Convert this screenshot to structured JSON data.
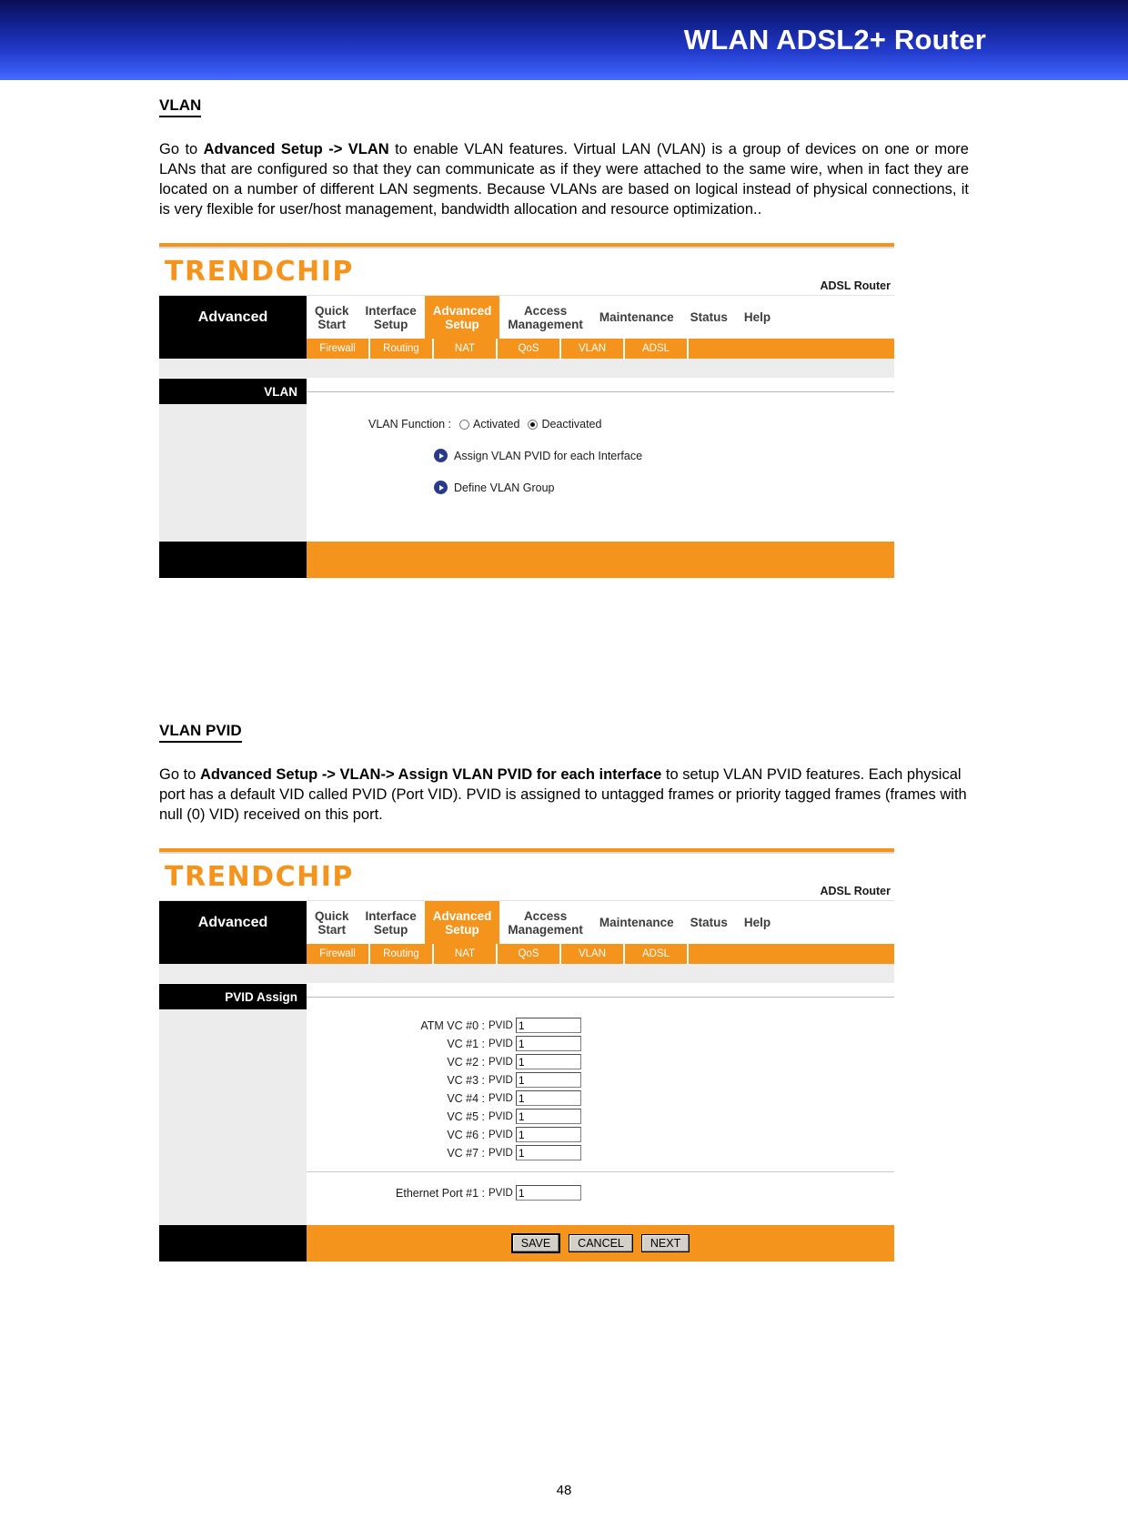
{
  "banner": {
    "title": "WLAN ADSL2+ Router"
  },
  "sections": {
    "vlan": {
      "heading": "VLAN",
      "paragraph": "Go to Advanced Setup -> VLAN to enable VLAN features. Virtual LAN (VLAN) is a group of devices on one or more LANs that are configured so that they can communicate as if they were attached to the same wire, when in fact they are located on a number of different LAN segments. Because VLANs are based on logical instead of physical connections, it is very flexible for user/host management, bandwidth allocation and resource optimization..",
      "paragraph_bold": "Advanced Setup -> VLAN"
    },
    "vlan_pvid": {
      "heading": "VLAN PVID",
      "paragraph": "Go to Advanced Setup -> VLAN-> Assign VLAN PVID for each interface to setup VLAN PVID features. Each physical port has a default VID called PVID (Port VID). PVID is assigned to untagged frames or priority tagged frames (frames with null (0) VID) received on this port.",
      "paragraph_bold": "Advanced Setup -> VLAN-> Assign VLAN PVID for each interface"
    }
  },
  "shot1": {
    "brand": "TRENDCHIP",
    "brand_right": "ADSL Router",
    "nav_left_label": "Advanced",
    "tabs": [
      {
        "label": "Quick\nStart",
        "active": false
      },
      {
        "label": "Interface\nSetup",
        "active": false
      },
      {
        "label": "Advanced\nSetup",
        "active": true
      },
      {
        "label": "Access\nManagement",
        "active": false
      },
      {
        "label": "Maintenance",
        "active": false
      },
      {
        "label": "Status",
        "active": false
      },
      {
        "label": "Help",
        "active": false
      }
    ],
    "subtabs": [
      "Firewall",
      "Routing",
      "NAT",
      "QoS",
      "VLAN",
      "ADSL"
    ],
    "panel_title": "VLAN",
    "vlan_function_label": "VLAN Function :",
    "radio_activated": "Activated",
    "radio_deactivated": "Deactivated",
    "selected_radio": "Deactivated",
    "links": [
      "Assign VLAN PVID for each Interface",
      "Define VLAN Group"
    ]
  },
  "shot2": {
    "brand": "TRENDCHIP",
    "brand_right": "ADSL Router",
    "nav_left_label": "Advanced",
    "tabs": [
      {
        "label": "Quick\nStart",
        "active": false
      },
      {
        "label": "Interface\nSetup",
        "active": false
      },
      {
        "label": "Advanced\nSetup",
        "active": true
      },
      {
        "label": "Access\nManagement",
        "active": false
      },
      {
        "label": "Maintenance",
        "active": false
      },
      {
        "label": "Status",
        "active": false
      },
      {
        "label": "Help",
        "active": false
      }
    ],
    "subtabs": [
      "Firewall",
      "Routing",
      "NAT",
      "QoS",
      "VLAN",
      "ADSL"
    ],
    "panel_title": "PVID Assign",
    "pvid_sub_label": "PVID",
    "vc_rows": [
      {
        "label": "ATM VC #0 :",
        "value": "1"
      },
      {
        "label": "VC #1 :",
        "value": "1"
      },
      {
        "label": "VC #2 :",
        "value": "1"
      },
      {
        "label": "VC #3 :",
        "value": "1"
      },
      {
        "label": "VC #4 :",
        "value": "1"
      },
      {
        "label": "VC #5 :",
        "value": "1"
      },
      {
        "label": "VC #6 :",
        "value": "1"
      },
      {
        "label": "VC #7 :",
        "value": "1"
      }
    ],
    "ethernet_row": {
      "label": "Ethernet Port #1 :",
      "value": "1"
    },
    "buttons": [
      "SAVE",
      "CANCEL",
      "NEXT"
    ]
  },
  "footer": {
    "page_number": "48"
  },
  "colors": {
    "accent_orange": "#f5941d",
    "banner_blue": "#2139c8",
    "panel_black": "#000000",
    "bullet_navy": "#283a8e"
  }
}
